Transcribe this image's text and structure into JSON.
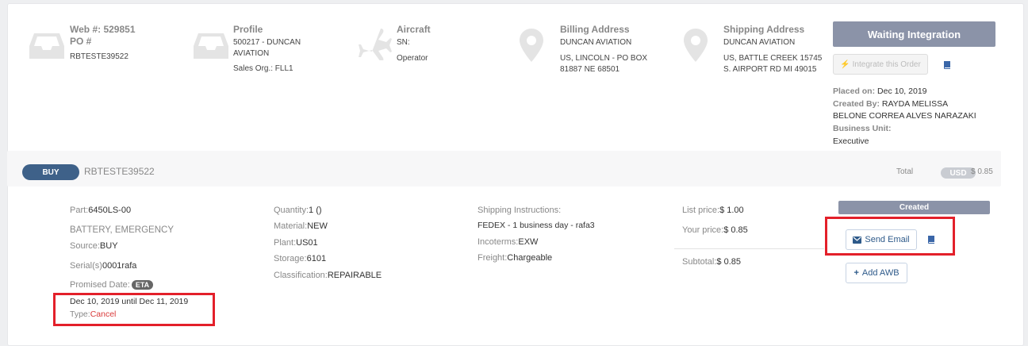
{
  "header": {
    "web_label": "Web #: 529851",
    "po_label": "PO #",
    "po_value": "RBTESTE39522",
    "profile_title": "Profile",
    "profile_line1": "500217 - DUNCAN",
    "profile_line2": "AVIATION",
    "profile_sales": "Sales Org.: FLL1",
    "aircraft_title": "Aircraft",
    "aircraft_sn": "SN:",
    "aircraft_operator": "Operator",
    "billing_title": "Billing Address",
    "billing_line1": "DUNCAN AVIATION",
    "billing_line2": "US, LINCOLN - PO BOX",
    "billing_line3": "81887 NE 68501",
    "shipping_title": "Shipping Address",
    "shipping_line1": "DUNCAN AVIATION",
    "shipping_line2": "US, BATTLE CREEK 15745",
    "shipping_line3": "S. AIRPORT RD MI 49015"
  },
  "status": {
    "waiting_label": "Waiting Integration",
    "integrate_label": "Integrate this Order",
    "placed_label": "Placed on:",
    "placed_value": "Dec 10, 2019",
    "created_by_label": "Created By:",
    "created_by_value1": "RAYDA MELISSA",
    "created_by_value2": "BELONE CORREA ALVES NARAZAKI",
    "business_unit_label": "Business Unit:",
    "business_unit_value": "Executive"
  },
  "order": {
    "type_pill": "BUY",
    "id": "RBTESTE39522",
    "total_label": "Total",
    "currency": "USD",
    "total_amount": "$ 0.85"
  },
  "item": {
    "part_label": "Part:",
    "part_value": "6450LS-00",
    "description": "BATTERY, EMERGENCY",
    "source_label": "Source:",
    "source_value": "BUY",
    "serial_label": "Serial(s)",
    "serial_value": "0001rafa",
    "promised_label": "Promised Date:",
    "eta_badge": "ETA",
    "promised_range": "Dec 10, 2019 until Dec 11, 2019",
    "type_label": "Type:",
    "type_value": "Cancel",
    "quantity_label": "Quantity:",
    "quantity_value": "1 ()",
    "material_label": "Material:",
    "material_value": "NEW",
    "plant_label": "Plant:",
    "plant_value": "US01",
    "storage_label": "Storage:",
    "storage_value": "6101",
    "classification_label": "Classification:",
    "classification_value": "REPAIRABLE",
    "shipping_instr_label": "Shipping Instructions:",
    "shipping_instr_value": "FEDEX - 1 business day - rafa3",
    "incoterms_label": "Incoterms:",
    "incoterms_value": "EXW",
    "freight_label": "Freight:",
    "freight_value": "Chargeable",
    "list_price_label": "List price:",
    "list_price_value": "$ 1.00",
    "your_price_label": "Your price:",
    "your_price_value": "$ 0.85",
    "subtotal_label": "Subtotal:",
    "subtotal_value": "$ 0.85",
    "status_badge": "Created",
    "send_email_label": "Send Email",
    "add_awb_label": "Add AWB"
  },
  "colors": {
    "highlight": "#e3202a",
    "status_gray": "#8b93a8",
    "buy_pill": "#3e6189"
  }
}
